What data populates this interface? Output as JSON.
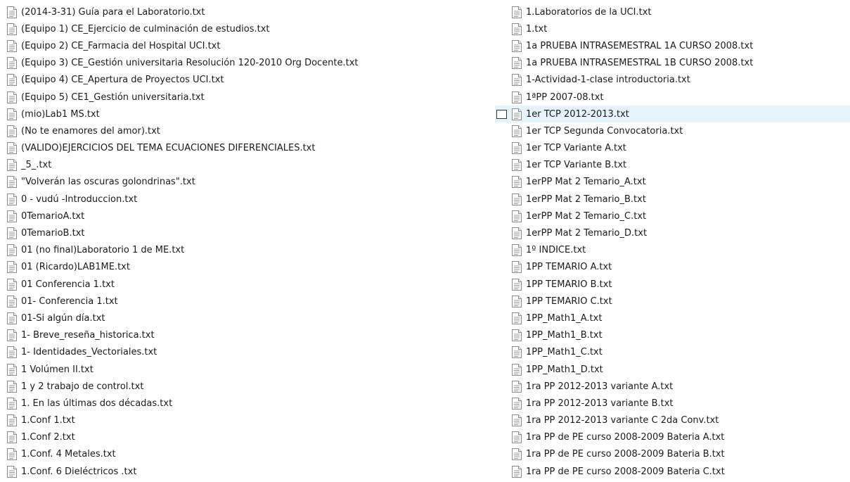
{
  "icon": "text-document-icon",
  "colors": {
    "selection_background": "#e5f3fb",
    "text": "#1a1a1a"
  },
  "left_column": [
    "(2014-3-31) Guía para el Laboratorio.txt",
    "(Equipo 1) CE_Ejercicio de culminación de estudios.txt",
    "(Equipo 2) CE_Farmacia del Hospital UCI.txt",
    "(Equipo 3) CE_Gestión universitaria Resolución 120-2010  Org Docente.txt",
    "(Equipo 4) CE_Apertura de Proyectos UCI.txt",
    "(Equipo 5) CE1_Gestión universitaria.txt",
    "(mio)Lab1 MS.txt",
    "(No te enamores del amor).txt",
    "(VALIDO)EJERCICIOS DEL TEMA ECUACIONES DIFERENCIALES.txt",
    "_5_.txt",
    "\"Volverán las oscuras golondrinas\".txt",
    "0 - vudú -Introduccion.txt",
    "0TemarioA.txt",
    "0TemarioB.txt",
    "01 (no final)Laboratorio 1 de ME.txt",
    "01 (Ricardo)LAB1ME.txt",
    "01 Conferencia 1.txt",
    "01- Conferencia 1.txt",
    "01-Si algún día.txt",
    "1- Breve_reseña_historica.txt",
    "1- Identidades_Vectoriales.txt",
    "1 Volúmen II.txt",
    "1 y 2 trabajo de control.txt",
    "1. En las últimas dos décadas.txt",
    "1.Conf 1.txt",
    "1.Conf 2.txt",
    "1.Conf. 4 Metales.txt",
    "1.Conf. 6 Dieléctricos .txt"
  ],
  "right_column": [
    "1.Laboratorios de la UCI.txt",
    "1.txt",
    "1a PRUEBA INTRASEMESTRAL 1A  CURSO 2008.txt",
    "1a PRUEBA INTRASEMESTRAL 1B  CURSO 2008.txt",
    "1-Actividad-1-clase introductoria.txt",
    "1ªPP 2007-08.txt",
    "1er TCP 2012-2013.txt",
    "1er TCP Segunda Convocatoria.txt",
    "1er TCP Variante A.txt",
    "1er TCP Variante B.txt",
    "1erPP Mat 2 Temario_A.txt",
    "1erPP Mat 2 Temario_B.txt",
    "1erPP Mat 2 Temario_C.txt",
    "1erPP Mat 2 Temario_D.txt",
    "1º INDICE.txt",
    "1PP TEMARIO A.txt",
    "1PP TEMARIO B.txt",
    "1PP TEMARIO C.txt",
    "1PP_Math1_A.txt",
    "1PP_Math1_B.txt",
    "1PP_Math1_C.txt",
    "1PP_Math1_D.txt",
    "1ra PP 2012-2013 variante A.txt",
    "1ra PP 2012-2013 variante B.txt",
    "1ra PP 2012-2013 variante C 2da Conv.txt",
    "1ra PP de PE curso 2008-2009 Bateria A.txt",
    "1ra PP de PE curso 2008-2009 Bateria B.txt",
    "1ra PP de PE curso 2008-2009 Bateria C.txt"
  ],
  "hovered_item_index_right": 6
}
